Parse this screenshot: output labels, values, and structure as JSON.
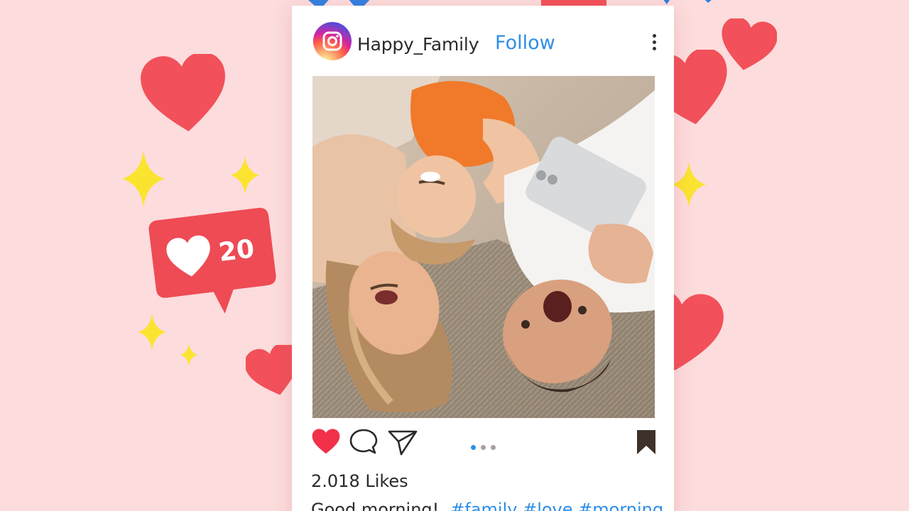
{
  "post": {
    "username": "Happy_Family",
    "separator": "·",
    "follow_label": "Follow",
    "more_icon": "more-vertical-icon",
    "likes": "2.018 Likes",
    "caption_text": "Good morning!",
    "hashtags": "#family #love #morning",
    "carousel": {
      "pages": 3,
      "active_index": 0
    },
    "actions": [
      "like-heart-icon",
      "comment-icon",
      "share-send-icon",
      "bookmark-icon"
    ],
    "liked": true
  },
  "notification": {
    "icon": "heart-icon",
    "count": "20"
  },
  "colors": {
    "background": "#fcdcdc",
    "heart_red": "#f2505a",
    "link_blue": "#2f8ee6",
    "sparkle_yellow": "#fbe42f",
    "notification_bg": "#ee4b55"
  }
}
